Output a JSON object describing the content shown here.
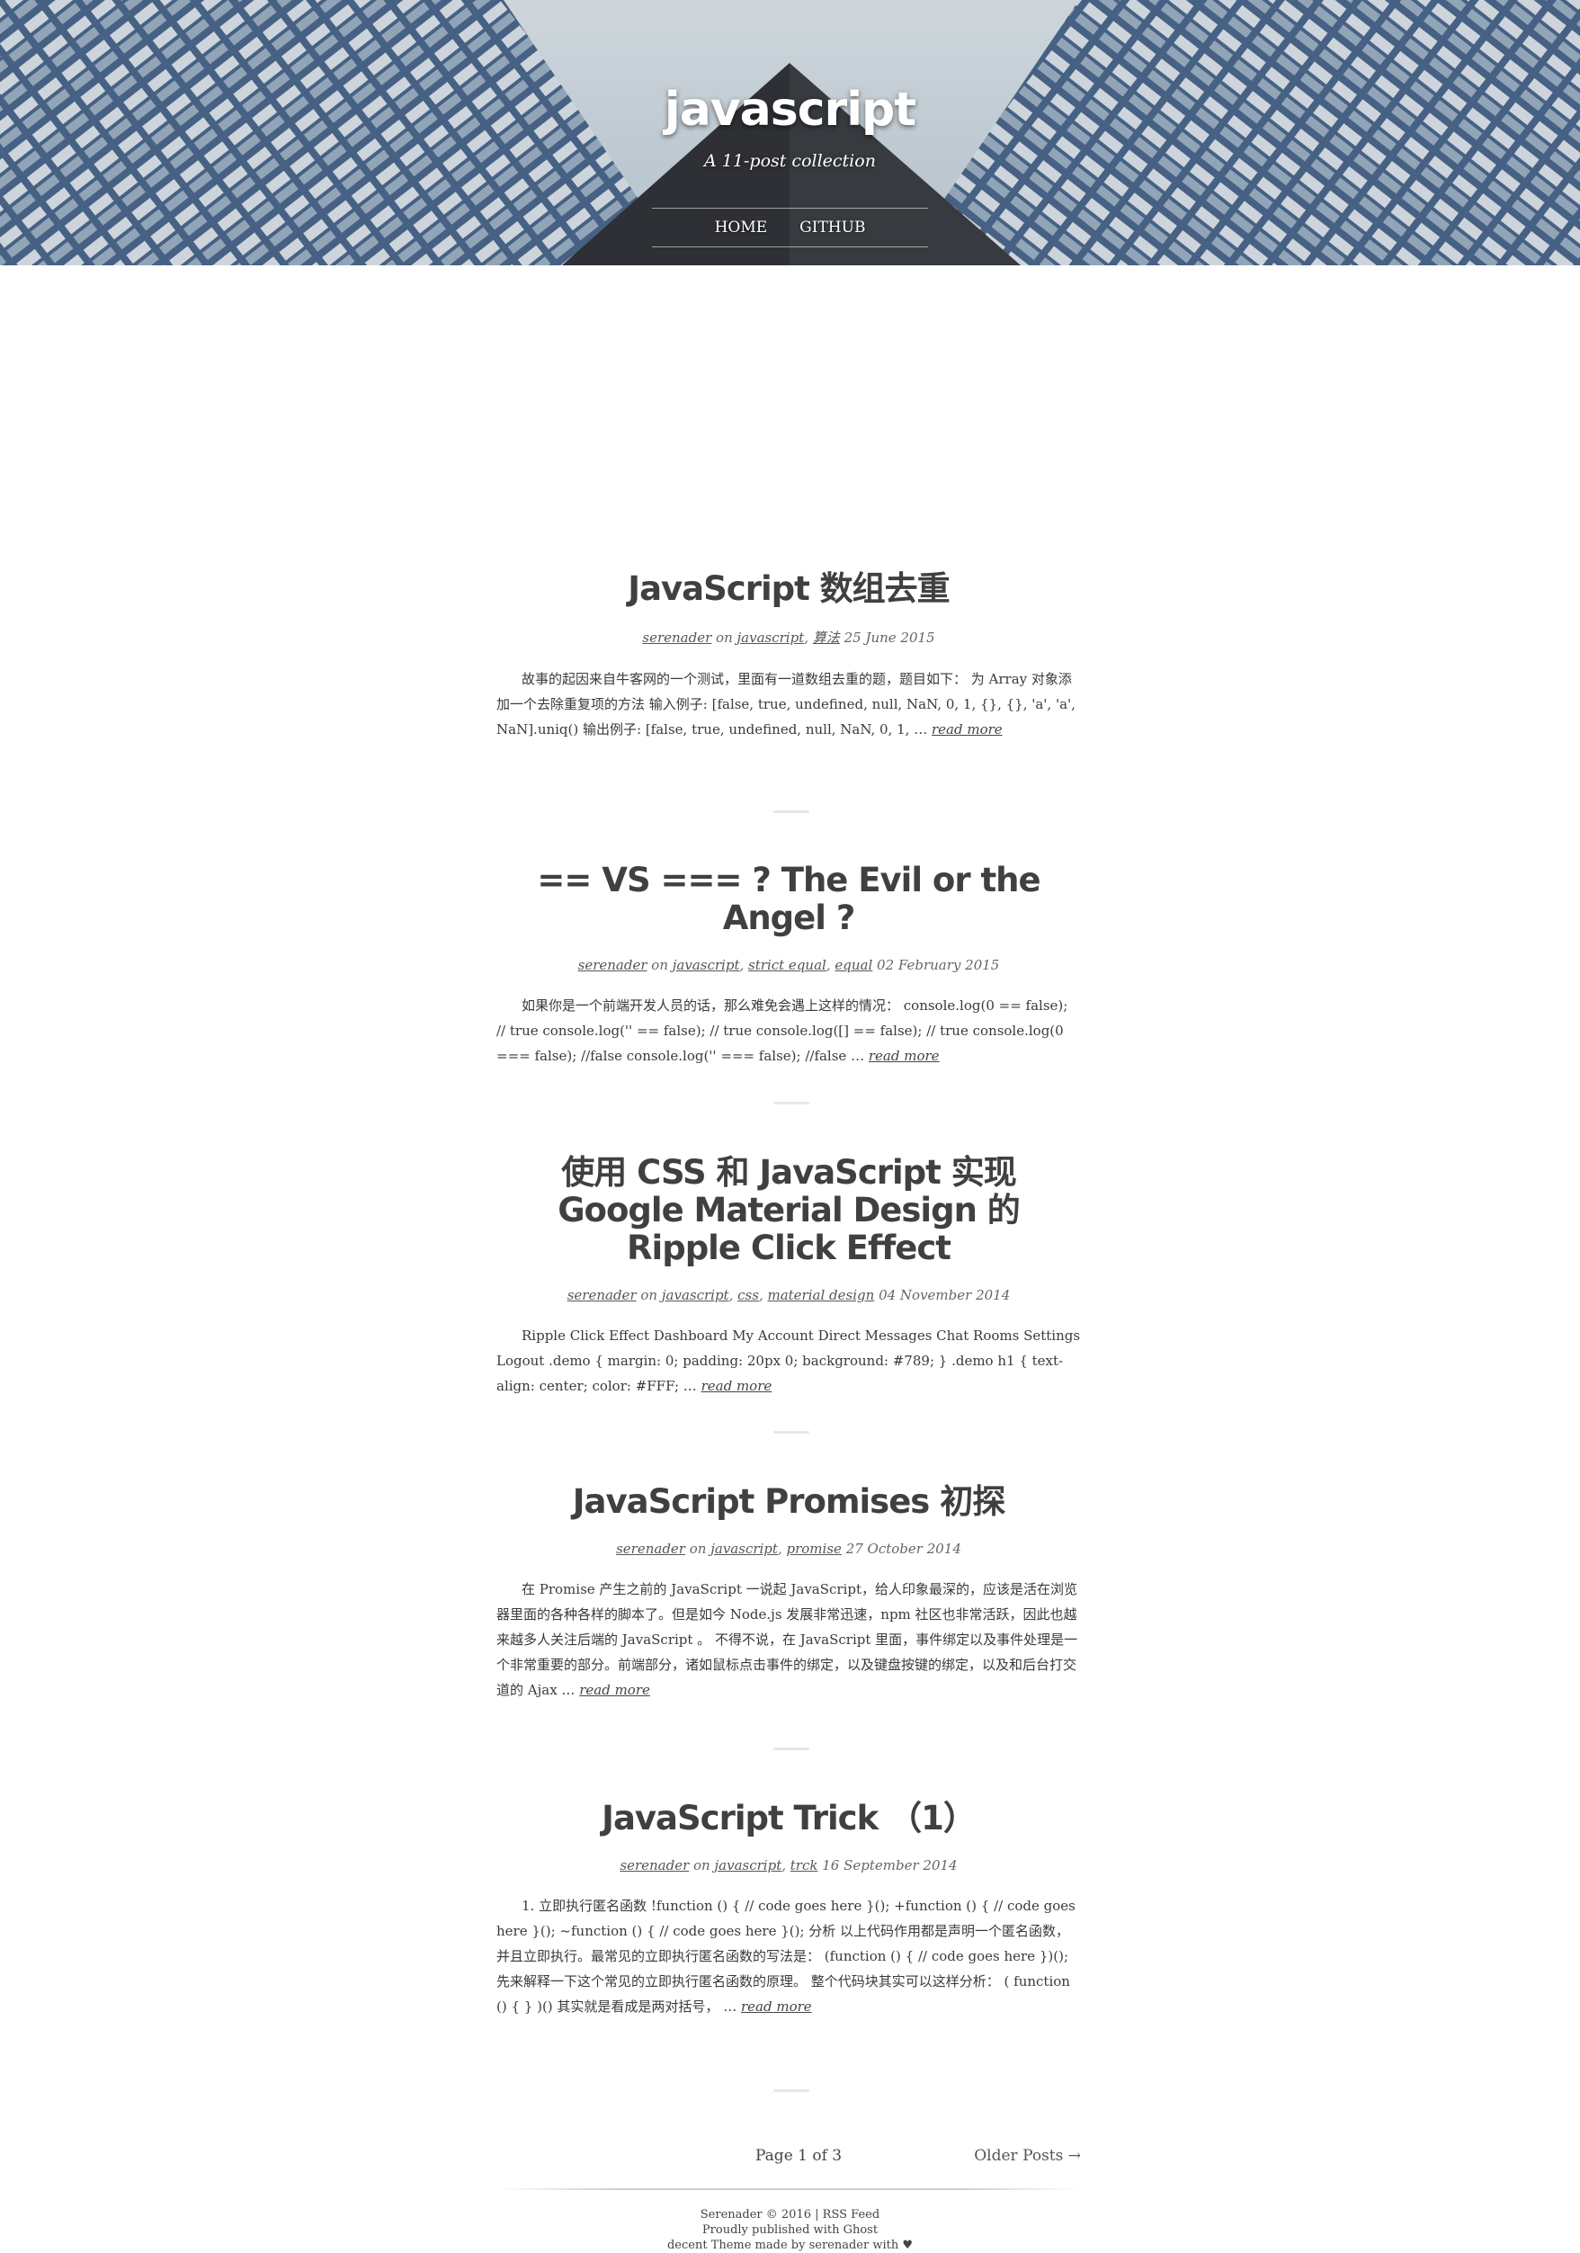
{
  "header": {
    "title": "javascript",
    "description": "A 11-post collection",
    "nav": [
      {
        "label": "HOME"
      },
      {
        "label": "GITHUB"
      }
    ]
  },
  "posts": [
    {
      "title": "JavaScript 数组去重",
      "author": "serenader",
      "on": "on",
      "tags": [
        "javascript",
        "算法"
      ],
      "date": "25 June 2015",
      "excerpt": "故事的起因来自牛客网的一个测试，里面有一道数组去重的题，题目如下： 为 Array 对象添加一个去除重复项的方法 输入例子: [false, true, undefined, null, NaN, 0, 1, {}, {}, 'a', 'a', NaN].uniq() 输出例子: [false, true, undefined, null, NaN, 0, 1, …",
      "read_more": "read more"
    },
    {
      "title": "== VS === ? The Evil or the Angel ?",
      "author": "serenader",
      "on": "on",
      "tags": [
        "javascript",
        "strict equal",
        "equal"
      ],
      "date": "02 February 2015",
      "excerpt": "如果你是一个前端开发人员的话，那么难免会遇上这样的情况： console.log(0 == false); // true console.log('' == false); // true console.log([] == false); // true console.log(0 === false); //false console.log('' === false); //false …",
      "read_more": "read more"
    },
    {
      "title": "使用 CSS 和 JavaScript 实现 Google Material Design 的 Ripple Click Effect",
      "author": "serenader",
      "on": "on",
      "tags": [
        "javascript",
        "css",
        "material design"
      ],
      "date": "04 November 2014",
      "excerpt": "Ripple Click Effect Dashboard My Account Direct Messages Chat Rooms Settings Logout .demo { margin: 0; padding: 20px 0; background: #789; } .demo h1 { text-align: center; color: #FFF; …",
      "read_more": "read more"
    },
    {
      "title": "JavaScript Promises 初探",
      "author": "serenader",
      "on": "on",
      "tags": [
        "javascript",
        "promise"
      ],
      "date": "27 October 2014",
      "excerpt": "在 Promise 产生之前的 JavaScript 一说起 JavaScript，给人印象最深的，应该是活在浏览器里面的各种各样的脚本了。但是如今 Node.js 发展非常迅速，npm 社区也非常活跃，因此也越来越多人关注后端的 JavaScript 。 不得不说，在 JavaScript 里面，事件绑定以及事件处理是一个非常重要的部分。前端部分，诸如鼠标点击事件的绑定，以及键盘按键的绑定，以及和后台打交道的 Ajax …",
      "read_more": "read more"
    },
    {
      "title": "JavaScript Trick （1）",
      "author": "serenader",
      "on": "on",
      "tags": [
        "javascript",
        "trck"
      ],
      "date": "16 September 2014",
      "excerpt": "1. 立即执行匿名函数 !function () { // code goes here }(); +function () { // code goes here }(); ~function () { // code goes here }(); 分析 以上代码作用都是声明一个匿名函数，并且立即执行。最常见的立即执行匿名函数的写法是： (function () { // code goes here })(); 先来解释一下这个常见的立即执行匿名函数的原理。 整个代码块其实可以这样分析： ( function () { } )() 其实就是看成是两对括号， …",
      "read_more": "read more"
    }
  ],
  "pagination": {
    "page": "Page 1 of 3",
    "older": "Older Posts →"
  },
  "footer": {
    "line1_owner": "Serenader © 2016",
    "line1_sep": "|",
    "line1_rss": "RSS Feed",
    "line2_prefix": "Proudly published with",
    "line2_ghost": "Ghost",
    "line3_prefix": "decent Theme made by",
    "line3_author": "serenader",
    "line3_suffix": "with ♥"
  }
}
